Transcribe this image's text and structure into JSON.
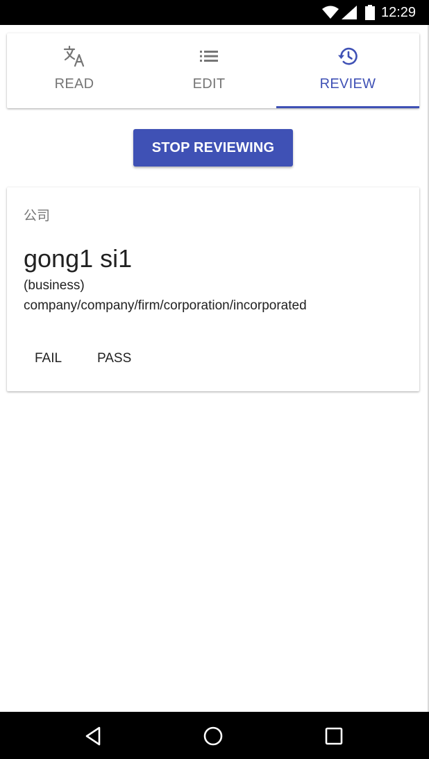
{
  "status_bar": {
    "time": "12:29",
    "icons": [
      "wifi-icon",
      "cell-signal-icon",
      "battery-icon"
    ]
  },
  "tabs": [
    {
      "label": "READ",
      "icon": "translate-icon",
      "active": false
    },
    {
      "label": "EDIT",
      "icon": "list-icon",
      "active": false
    },
    {
      "label": "REVIEW",
      "icon": "history-icon",
      "active": true
    }
  ],
  "stop_button": {
    "label": "STOP REVIEWING"
  },
  "card": {
    "chinese": "公司",
    "pinyin": "gong1 si1",
    "part_of_speech": "(business)",
    "definition": "company/company/firm/corporation/incorporated",
    "fail_label": "FAIL",
    "pass_label": "PASS"
  },
  "navigation": {
    "buttons": [
      "back-icon",
      "home-icon",
      "recents-icon"
    ]
  },
  "colors": {
    "accent": "#3f51b5",
    "tab_inactive": "#757575",
    "text_primary": "#212121",
    "status_bar": "#000000"
  }
}
